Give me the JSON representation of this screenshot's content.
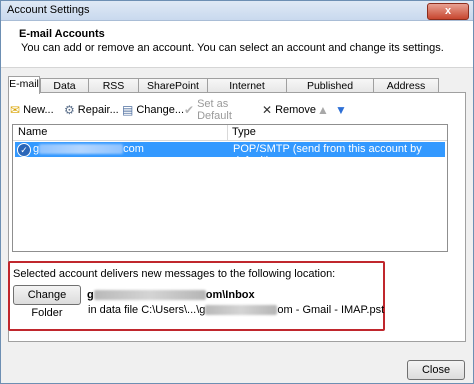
{
  "window": {
    "title": "Account Settings",
    "close_glyph": "x"
  },
  "header": {
    "title": "E-mail Accounts",
    "description": "You can add or remove an account. You can select an account and change its settings."
  },
  "tabs": [
    {
      "label": "E-mail",
      "active": true
    },
    {
      "label": "Data Files"
    },
    {
      "label": "RSS Feeds"
    },
    {
      "label": "SharePoint Lists"
    },
    {
      "label": "Internet Calendars"
    },
    {
      "label": "Published Calendars"
    },
    {
      "label": "Address Books"
    }
  ],
  "toolbar": {
    "new_label": "New...",
    "repair_label": "Repair...",
    "change_label": "Change...",
    "set_default_label": "Set as Default",
    "remove_label": "Remove",
    "icons": [
      "new-icon",
      "repair-icon",
      "change-icon",
      "checkmark-icon",
      "remove-x-icon",
      "arrow-up-icon",
      "arrow-down-icon"
    ]
  },
  "accounts_list": {
    "columns": [
      "Name",
      "Type"
    ],
    "rows": [
      {
        "name_prefix": "g",
        "name_suffix": "com",
        "type": "POP/SMTP (send from this account by default)"
      }
    ]
  },
  "delivery": {
    "label": "Selected account delivers new messages to the following location:",
    "change_folder_label": "Change Folder",
    "folder_prefix": "g",
    "folder_suffix": "om\\Inbox",
    "data_file_prefix": "in data file C:\\Users\\...\\g",
    "data_file_suffix": "om - Gmail - IMAP.pst"
  },
  "footer": {
    "close_label": "Close"
  },
  "colors": {
    "selection": "#3399ff",
    "highlight_box": "#c0272d",
    "title_bar": "#c9d9ee"
  }
}
